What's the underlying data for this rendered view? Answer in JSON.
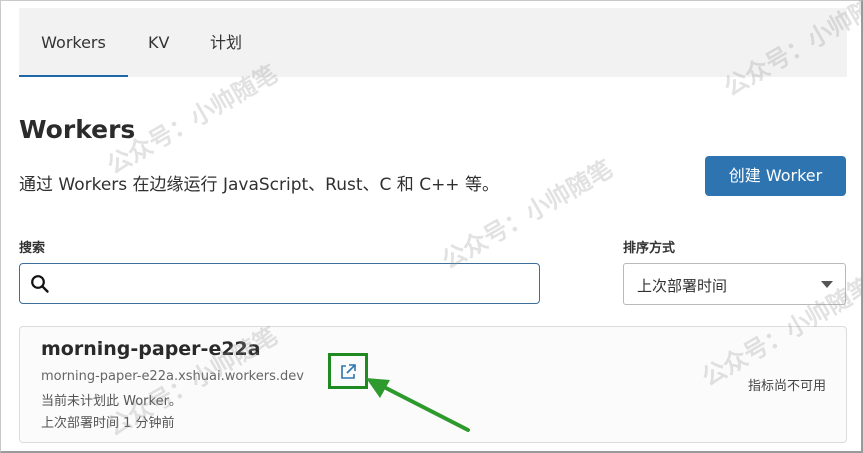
{
  "tabs": [
    {
      "label": "Workers",
      "active": true
    },
    {
      "label": "KV",
      "active": false
    },
    {
      "label": "计划",
      "active": false
    }
  ],
  "page": {
    "title": "Workers",
    "description": "通过 Workers 在边缘运行 JavaScript、Rust、C 和 C++ 等。",
    "create_button": "创建 Worker"
  },
  "search": {
    "label": "搜索",
    "value": "",
    "icon": "search-icon"
  },
  "sort": {
    "label": "排序方式",
    "selected": "上次部署时间",
    "icon": "chevron-down-icon"
  },
  "workers": [
    {
      "name": "morning-paper-e22a",
      "url": "morning-paper-e22a.xshuai.workers.dev",
      "status": "当前未计划此 Worker。",
      "last_deploy": "上次部署时间 1 分钟前",
      "metrics": "指标尚不可用",
      "link_icon": "external-link-icon"
    }
  ],
  "watermark": "公众号：小帅随笔",
  "colors": {
    "accent": "#2e74b0",
    "highlight": "#1f8a1f",
    "tab_underline": "#1e6aa8"
  }
}
